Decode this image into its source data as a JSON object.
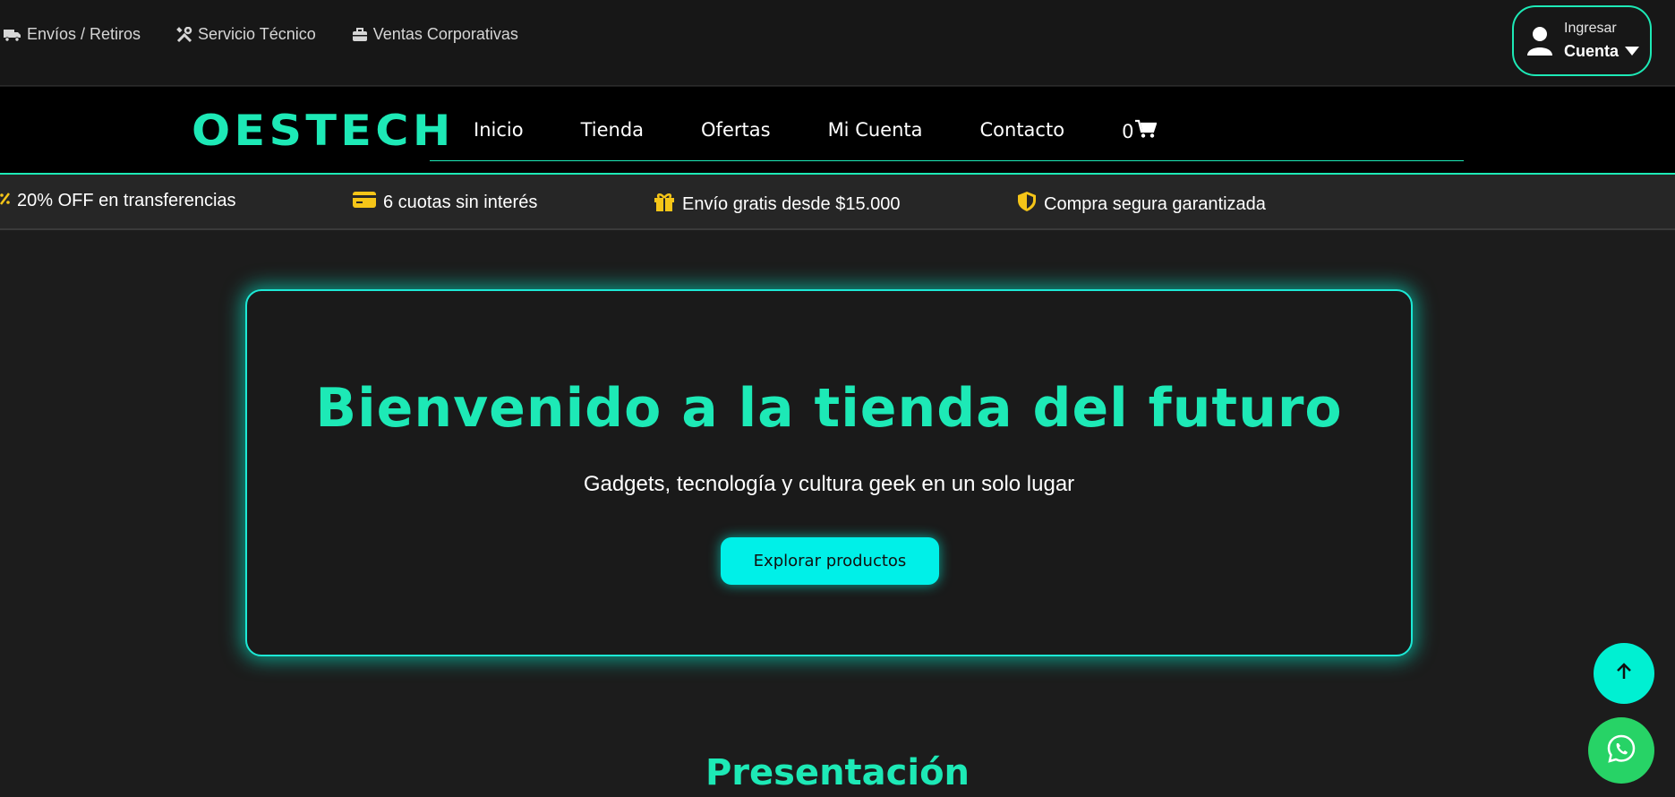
{
  "topbar": {
    "links": [
      {
        "label": "Envíos / Retiros",
        "icon": "truck-icon"
      },
      {
        "label": "Servicio Técnico",
        "icon": "tools-icon"
      },
      {
        "label": "Ventas Corporativas",
        "icon": "briefcase-icon"
      }
    ],
    "account": {
      "small_label": "Ingresar",
      "main_label": "Cuenta",
      "icon": "user-icon"
    }
  },
  "nav": {
    "logo": "OESTECH",
    "items": [
      "Inicio",
      "Tienda",
      "Ofertas",
      "Mi Cuenta",
      "Contacto"
    ],
    "cart_count": "0"
  },
  "promo": [
    {
      "label": "20% OFF en transferencias",
      "icon": "percent-icon"
    },
    {
      "label": "6 cuotas sin interés",
      "icon": "credit-card-icon"
    },
    {
      "label": "Envío gratis desde $15.000",
      "icon": "gift-icon"
    },
    {
      "label": "Compra segura garantizada",
      "icon": "shield-icon"
    }
  ],
  "hero": {
    "title": "Bienvenido a la tienda del futuro",
    "subtitle": "Gadgets, tecnología y cultura geek en un solo lugar",
    "cta": "Explorar productos"
  },
  "section": {
    "title": "Presentación"
  },
  "colors": {
    "accent": "#1de9b6",
    "cta": "#00f0e8",
    "promo_icon": "#f5c518",
    "whatsapp": "#27d366"
  }
}
